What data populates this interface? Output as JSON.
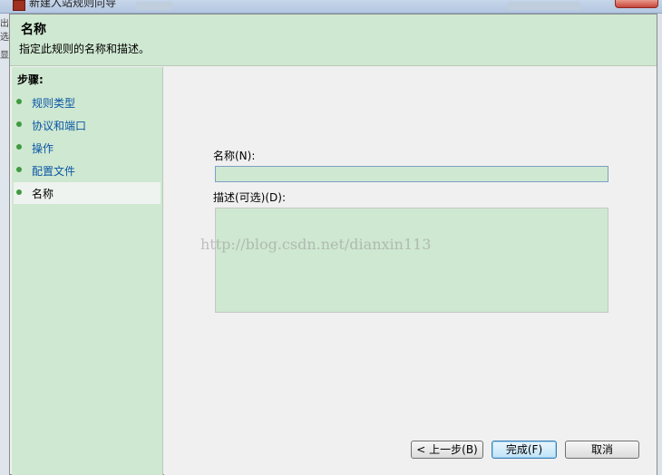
{
  "window": {
    "title": "新建入站规则向导"
  },
  "side_strip": [
    "出",
    "选",
    "显"
  ],
  "header": {
    "title": "名称",
    "subtitle": "指定此规则的名称和描述。"
  },
  "steps": {
    "label": "步骤:",
    "items": [
      {
        "label": "规则类型"
      },
      {
        "label": "协议和端口"
      },
      {
        "label": "操作"
      },
      {
        "label": "配置文件"
      },
      {
        "label": "名称"
      }
    ],
    "current_index": 4
  },
  "form": {
    "name_label": "名称(N):",
    "name_value": "",
    "desc_label": "描述(可选)(D):",
    "desc_value": ""
  },
  "watermark": "http://blog.csdn.net/dianxin113",
  "buttons": {
    "back": "< 上一步(B)",
    "finish": "完成(F)",
    "cancel": "取消"
  },
  "colors": {
    "panel_bg": "#cfe8d1",
    "step_link": "#0b56a6",
    "step_dot": "#3f9a3f"
  }
}
